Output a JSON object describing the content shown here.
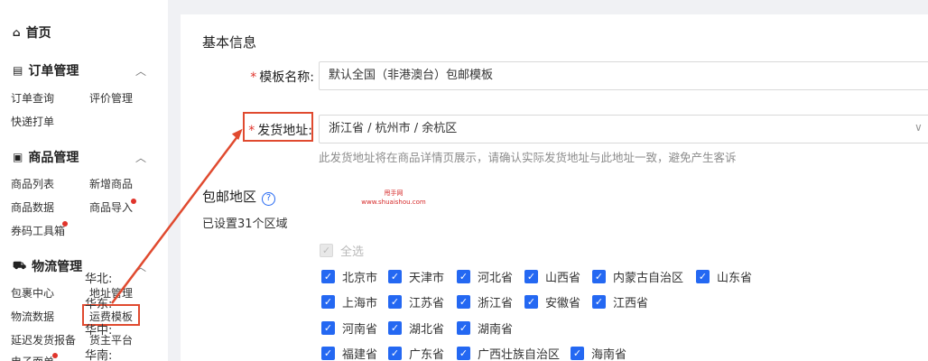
{
  "sidebar": {
    "home": {
      "icon": "home-icon",
      "label": "首页"
    },
    "groups": [
      {
        "title": "订单管理",
        "icon": "order-icon",
        "items": [
          "订单查询",
          "评价管理",
          "快递打单"
        ]
      },
      {
        "title": "商品管理",
        "icon": "goods-icon",
        "items": [
          "商品列表",
          "新增商品",
          "商品数据",
          "商品导入",
          "券码工具箱"
        ]
      },
      {
        "title": "物流管理",
        "icon": "logistics-icon",
        "items": [
          "包裹中心",
          "地址管理",
          "物流数据",
          "运费模板",
          "延迟发货报备",
          "货主平台",
          "电子面单"
        ]
      }
    ]
  },
  "main": {
    "basic_info_title": "基本信息",
    "template_name": {
      "label": "模板名称:",
      "value": "默认全国（非港澳台）包邮模板"
    },
    "ship_address": {
      "label": "发货地址:",
      "value": "浙江省 / 杭州市 / 余杭区",
      "hint": "此发货地址将在商品详情页展示，请确认实际发货地址与此地址一致，避免产生客诉"
    },
    "free_area": {
      "title": "包邮地区",
      "help": "?",
      "count_text": "已设置31个区域",
      "select_all": "全选"
    },
    "regions": [
      {
        "label": "华北:",
        "provinces": [
          "北京市",
          "天津市",
          "河北省",
          "山西省",
          "内蒙古自治区",
          "山东省"
        ]
      },
      {
        "label": "华东:",
        "provinces": [
          "上海市",
          "江苏省",
          "浙江省",
          "安徽省",
          "江西省"
        ]
      },
      {
        "label": "华中:",
        "provinces": [
          "河南省",
          "湖北省",
          "湖南省"
        ]
      },
      {
        "label": "华南:",
        "provinces": [
          "福建省",
          "广东省",
          "广西壮族自治区",
          "海南省"
        ]
      }
    ]
  },
  "watermark": {
    "line1": "甩手网",
    "line2": "www.shuaishou.com"
  },
  "colors": {
    "accent": "#2468f2",
    "highlight": "#e04a2f",
    "required": "#e0342b"
  }
}
